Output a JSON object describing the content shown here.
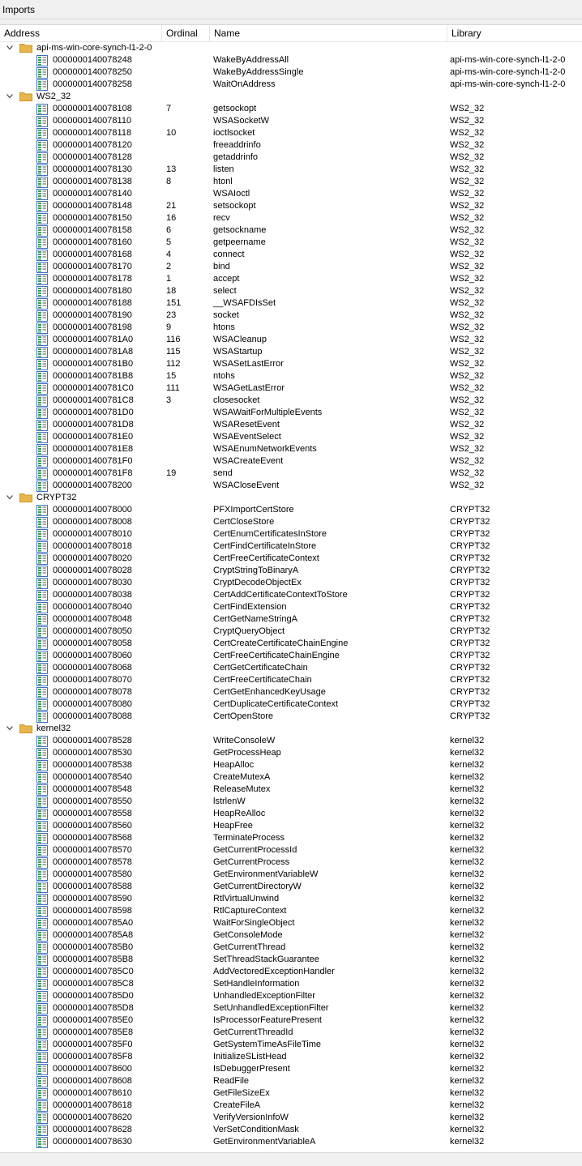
{
  "window": {
    "title": "Imports"
  },
  "columns": {
    "address": "Address",
    "ordinal": "Ordinal",
    "name": "Name",
    "library": "Library"
  },
  "groups": [
    {
      "name": "api-ms-win-core-synch-l1-2-0",
      "expanded": true,
      "items": [
        [
          "0000000140078248",
          "",
          "WakeByAddressAll",
          "api-ms-win-core-synch-l1-2-0"
        ],
        [
          "0000000140078250",
          "",
          "WakeByAddressSingle",
          "api-ms-win-core-synch-l1-2-0"
        ],
        [
          "0000000140078258",
          "",
          "WaitOnAddress",
          "api-ms-win-core-synch-l1-2-0"
        ]
      ]
    },
    {
      "name": "WS2_32",
      "expanded": true,
      "items": [
        [
          "0000000140078108",
          "7",
          "getsockopt",
          "WS2_32"
        ],
        [
          "0000000140078110",
          "",
          "WSASocketW",
          "WS2_32"
        ],
        [
          "0000000140078118",
          "10",
          "ioctlsocket",
          "WS2_32"
        ],
        [
          "0000000140078120",
          "",
          "freeaddrinfo",
          "WS2_32"
        ],
        [
          "0000000140078128",
          "",
          "getaddrinfo",
          "WS2_32"
        ],
        [
          "0000000140078130",
          "13",
          "listen",
          "WS2_32"
        ],
        [
          "0000000140078138",
          "8",
          "htonl",
          "WS2_32"
        ],
        [
          "0000000140078140",
          "",
          "WSAIoctl",
          "WS2_32"
        ],
        [
          "0000000140078148",
          "21",
          "setsockopt",
          "WS2_32"
        ],
        [
          "0000000140078150",
          "16",
          "recv",
          "WS2_32"
        ],
        [
          "0000000140078158",
          "6",
          "getsockname",
          "WS2_32"
        ],
        [
          "0000000140078160",
          "5",
          "getpeername",
          "WS2_32"
        ],
        [
          "0000000140078168",
          "4",
          "connect",
          "WS2_32"
        ],
        [
          "0000000140078170",
          "2",
          "bind",
          "WS2_32"
        ],
        [
          "0000000140078178",
          "1",
          "accept",
          "WS2_32"
        ],
        [
          "0000000140078180",
          "18",
          "select",
          "WS2_32"
        ],
        [
          "0000000140078188",
          "151",
          "__WSAFDIsSet",
          "WS2_32"
        ],
        [
          "0000000140078190",
          "23",
          "socket",
          "WS2_32"
        ],
        [
          "0000000140078198",
          "9",
          "htons",
          "WS2_32"
        ],
        [
          "00000001400781A0",
          "116",
          "WSACleanup",
          "WS2_32"
        ],
        [
          "00000001400781A8",
          "115",
          "WSAStartup",
          "WS2_32"
        ],
        [
          "00000001400781B0",
          "112",
          "WSASetLastError",
          "WS2_32"
        ],
        [
          "00000001400781B8",
          "15",
          "ntohs",
          "WS2_32"
        ],
        [
          "00000001400781C0",
          "111",
          "WSAGetLastError",
          "WS2_32"
        ],
        [
          "00000001400781C8",
          "3",
          "closesocket",
          "WS2_32"
        ],
        [
          "00000001400781D0",
          "",
          "WSAWaitForMultipleEvents",
          "WS2_32"
        ],
        [
          "00000001400781D8",
          "",
          "WSAResetEvent",
          "WS2_32"
        ],
        [
          "00000001400781E0",
          "",
          "WSAEventSelect",
          "WS2_32"
        ],
        [
          "00000001400781E8",
          "",
          "WSAEnumNetworkEvents",
          "WS2_32"
        ],
        [
          "00000001400781F0",
          "",
          "WSACreateEvent",
          "WS2_32"
        ],
        [
          "00000001400781F8",
          "19",
          "send",
          "WS2_32"
        ],
        [
          "0000000140078200",
          "",
          "WSACloseEvent",
          "WS2_32"
        ]
      ]
    },
    {
      "name": "CRYPT32",
      "expanded": true,
      "items": [
        [
          "0000000140078000",
          "",
          "PFXImportCertStore",
          "CRYPT32"
        ],
        [
          "0000000140078008",
          "",
          "CertCloseStore",
          "CRYPT32"
        ],
        [
          "0000000140078010",
          "",
          "CertEnumCertificatesInStore",
          "CRYPT32"
        ],
        [
          "0000000140078018",
          "",
          "CertFindCertificateInStore",
          "CRYPT32"
        ],
        [
          "0000000140078020",
          "",
          "CertFreeCertificateContext",
          "CRYPT32"
        ],
        [
          "0000000140078028",
          "",
          "CryptStringToBinaryA",
          "CRYPT32"
        ],
        [
          "0000000140078030",
          "",
          "CryptDecodeObjectEx",
          "CRYPT32"
        ],
        [
          "0000000140078038",
          "",
          "CertAddCertificateContextToStore",
          "CRYPT32"
        ],
        [
          "0000000140078040",
          "",
          "CertFindExtension",
          "CRYPT32"
        ],
        [
          "0000000140078048",
          "",
          "CertGetNameStringA",
          "CRYPT32"
        ],
        [
          "0000000140078050",
          "",
          "CryptQueryObject",
          "CRYPT32"
        ],
        [
          "0000000140078058",
          "",
          "CertCreateCertificateChainEngine",
          "CRYPT32"
        ],
        [
          "0000000140078060",
          "",
          "CertFreeCertificateChainEngine",
          "CRYPT32"
        ],
        [
          "0000000140078068",
          "",
          "CertGetCertificateChain",
          "CRYPT32"
        ],
        [
          "0000000140078070",
          "",
          "CertFreeCertificateChain",
          "CRYPT32"
        ],
        [
          "0000000140078078",
          "",
          "CertGetEnhancedKeyUsage",
          "CRYPT32"
        ],
        [
          "0000000140078080",
          "",
          "CertDuplicateCertificateContext",
          "CRYPT32"
        ],
        [
          "0000000140078088",
          "",
          "CertOpenStore",
          "CRYPT32"
        ]
      ]
    },
    {
      "name": "kernel32",
      "expanded": true,
      "items": [
        [
          "0000000140078528",
          "",
          "WriteConsoleW",
          "kernel32"
        ],
        [
          "0000000140078530",
          "",
          "GetProcessHeap",
          "kernel32"
        ],
        [
          "0000000140078538",
          "",
          "HeapAlloc",
          "kernel32"
        ],
        [
          "0000000140078540",
          "",
          "CreateMutexA",
          "kernel32"
        ],
        [
          "0000000140078548",
          "",
          "ReleaseMutex",
          "kernel32"
        ],
        [
          "0000000140078550",
          "",
          "lstrlenW",
          "kernel32"
        ],
        [
          "0000000140078558",
          "",
          "HeapReAlloc",
          "kernel32"
        ],
        [
          "0000000140078560",
          "",
          "HeapFree",
          "kernel32"
        ],
        [
          "0000000140078568",
          "",
          "TerminateProcess",
          "kernel32"
        ],
        [
          "0000000140078570",
          "",
          "GetCurrentProcessId",
          "kernel32"
        ],
        [
          "0000000140078578",
          "",
          "GetCurrentProcess",
          "kernel32"
        ],
        [
          "0000000140078580",
          "",
          "GetEnvironmentVariableW",
          "kernel32"
        ],
        [
          "0000000140078588",
          "",
          "GetCurrentDirectoryW",
          "kernel32"
        ],
        [
          "0000000140078590",
          "",
          "RtlVirtualUnwind",
          "kernel32"
        ],
        [
          "0000000140078598",
          "",
          "RtlCaptureContext",
          "kernel32"
        ],
        [
          "00000001400785A0",
          "",
          "WaitForSingleObject",
          "kernel32"
        ],
        [
          "00000001400785A8",
          "",
          "GetConsoleMode",
          "kernel32"
        ],
        [
          "00000001400785B0",
          "",
          "GetCurrentThread",
          "kernel32"
        ],
        [
          "00000001400785B8",
          "",
          "SetThreadStackGuarantee",
          "kernel32"
        ],
        [
          "00000001400785C0",
          "",
          "AddVectoredExceptionHandler",
          "kernel32"
        ],
        [
          "00000001400785C8",
          "",
          "SetHandleInformation",
          "kernel32"
        ],
        [
          "00000001400785D0",
          "",
          "UnhandledExceptionFilter",
          "kernel32"
        ],
        [
          "00000001400785D8",
          "",
          "SetUnhandledExceptionFilter",
          "kernel32"
        ],
        [
          "00000001400785E0",
          "",
          "IsProcessorFeaturePresent",
          "kernel32"
        ],
        [
          "00000001400785E8",
          "",
          "GetCurrentThreadId",
          "kernel32"
        ],
        [
          "00000001400785F0",
          "",
          "GetSystemTimeAsFileTime",
          "kernel32"
        ],
        [
          "00000001400785F8",
          "",
          "InitializeSListHead",
          "kernel32"
        ],
        [
          "0000000140078600",
          "",
          "IsDebuggerPresent",
          "kernel32"
        ],
        [
          "0000000140078608",
          "",
          "ReadFile",
          "kernel32"
        ],
        [
          "0000000140078610",
          "",
          "GetFileSizeEx",
          "kernel32"
        ],
        [
          "0000000140078618",
          "",
          "CreateFileA",
          "kernel32"
        ],
        [
          "0000000140078620",
          "",
          "VerifyVersionInfoW",
          "kernel32"
        ],
        [
          "0000000140078628",
          "",
          "VerSetConditionMask",
          "kernel32"
        ],
        [
          "0000000140078630",
          "",
          "GetEnvironmentVariableA",
          "kernel32"
        ]
      ]
    }
  ],
  "colors": {
    "folder": "#e8b64a",
    "icon_green": "#3c9a5a",
    "icon_blue": "#3a6fc2"
  }
}
